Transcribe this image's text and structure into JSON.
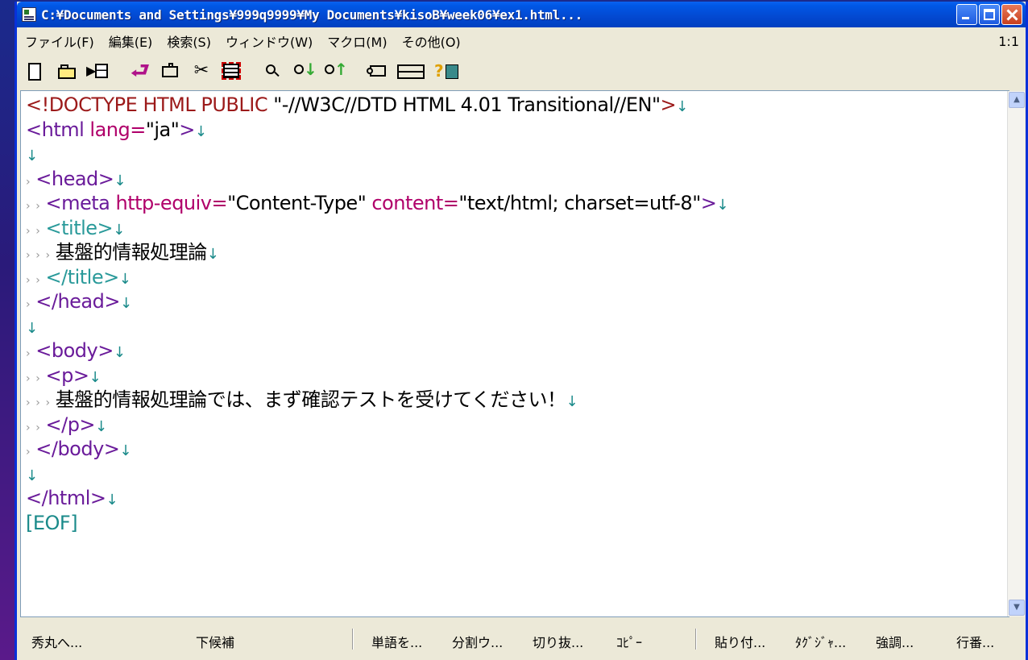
{
  "window": {
    "title": "C:¥Documents and Settings¥999q9999¥My Documents¥kisoB¥week06¥ex1.html..."
  },
  "menu": {
    "items": [
      "ファイル(F)",
      "編集(E)",
      "検索(S)",
      "ウィンドウ(W)",
      "マクロ(M)",
      "その他(O)"
    ],
    "cursor_position": "1:1"
  },
  "toolbar": {
    "icons": [
      "new-file-icon",
      "open-folder-icon",
      "save-icon",
      "undo-icon",
      "redo-box-icon",
      "cut-icon",
      "select-all-icon",
      "find-icon",
      "find-next-icon",
      "find-prev-icon",
      "tag-jump-icon",
      "split-window-icon",
      "help-icon"
    ]
  },
  "editor": {
    "lines": {
      "l1_doctype": "<!DOCTYPE HTML PUBLIC",
      "l1_str": " \"-//W3C//DTD HTML 4.01 Transitional//EN\"",
      "l1_end": ">",
      "l2_tag": "<html",
      "l2_attr": " lang=",
      "l2_val": "\"ja\"",
      "l2_end": ">",
      "l4_tag": "<head>",
      "l5_tag": "<meta",
      "l5_attr1": " http-equiv=",
      "l5_val1": "\"Content-Type\"",
      "l5_attr2": " content=",
      "l5_val2": "\"text/html; charset=utf-8\"",
      "l5_end": ">",
      "l6_tag": "<title>",
      "l7_text": "基盤的情報処理論",
      "l8_tag": "</title>",
      "l9_tag": "</head>",
      "l11_tag": "<body>",
      "l12_tag": "<p>",
      "l13_text": "基盤的情報処理論では、まず確認テストを受けてください！",
      "l14_tag": "</p>",
      "l15_tag": "</body>",
      "l17_tag": "</html>",
      "eof": "[EOF]",
      "newline_mark": "↓",
      "indent_mark": "›"
    }
  },
  "statusbar": {
    "items": [
      "秀丸へ...",
      "下候補",
      "単語を...",
      "分割ウ...",
      "切り抜...",
      "ｺﾋﾟｰ",
      "貼り付...",
      "ﾀｸﾞｼﾞｬ...",
      "強調...",
      "行番..."
    ]
  }
}
